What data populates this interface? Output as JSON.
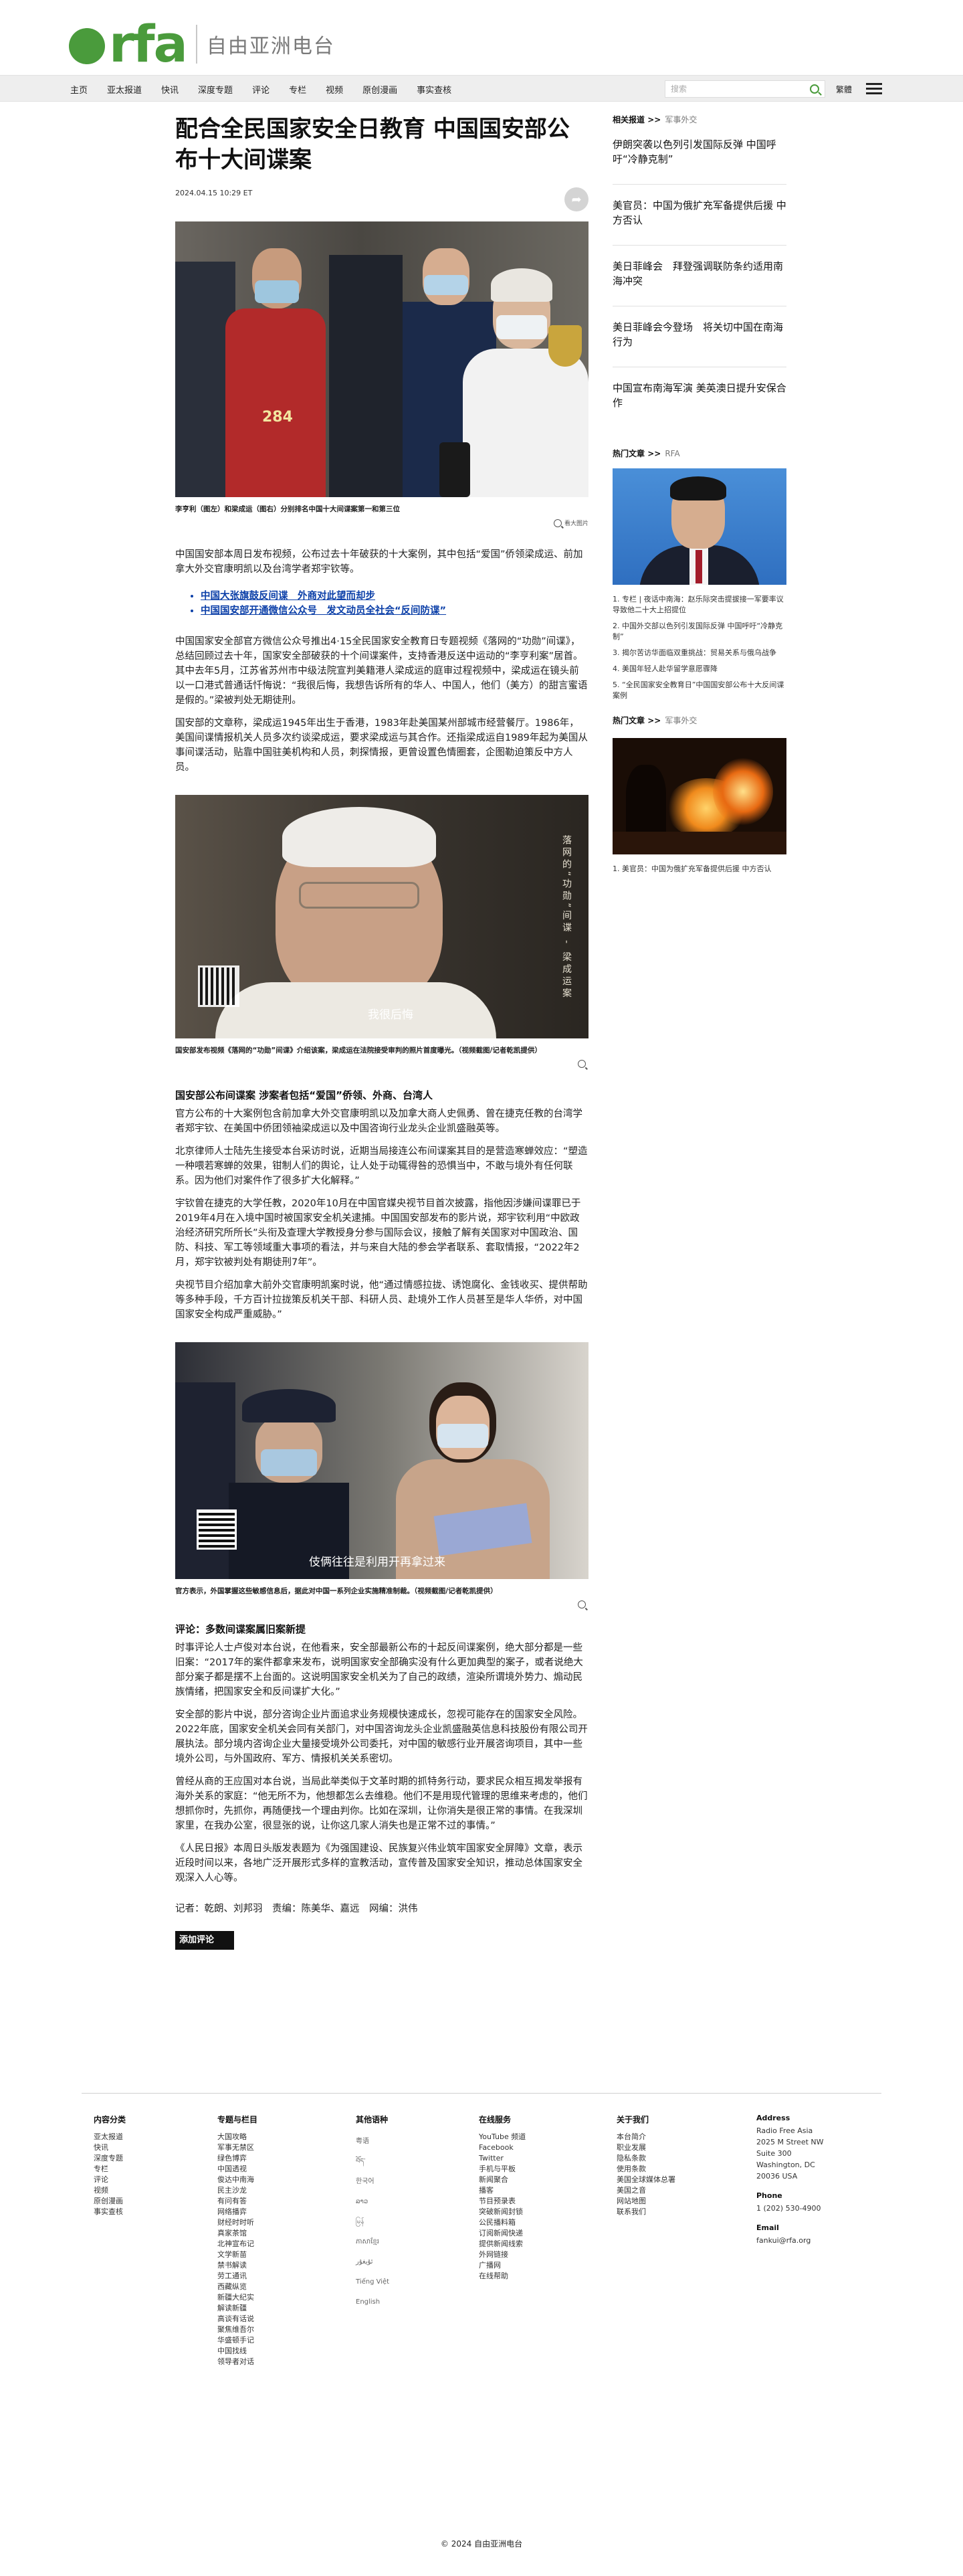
{
  "site": {
    "logo_text": "rfa",
    "name": "自由亚洲电台"
  },
  "nav": {
    "items": [
      "主页",
      "亚太报道",
      "快讯",
      "深度专题",
      "评论",
      "专栏",
      "视频",
      "原创漫画",
      "事实查核"
    ],
    "search_placeholder": "搜索",
    "lang_toggle": "繁體"
  },
  "article": {
    "headline": "配合全民国家安全日教育 中国国安部公布十大间谍案",
    "date": "2024.04.15 10:29 ET",
    "photo1_caption": "李亨利（图左）和梁成运（图右）分别排名中国十大间谍案第一和第三位",
    "enlarge_label": "看大图片",
    "para1": "中国国安部本周日发布视频，公布过去十年破获的十大案例，其中包括“爱国”侨领梁成运、前加拿大外交官康明凯以及台湾学者郑宇钦等。",
    "related": [
      "中国大张旗鼓反间谍　外商对此望而却步",
      "中国国安部开通微信公众号　发文动员全社会“反间防谍”"
    ],
    "para2": "中国国家安全部官方微信公众号推出4·15全民国家安全教育日专题视频《落网的“功勋”间谍》，总结回顾过去十年，国家安全部破获的十个间谍案件，支持香港反送中运动的“李亨利案”居首。其中去年5月，江苏省苏州市中级法院宣判美籍港人梁成运的庭审过程视频中，梁成运在镜头前以一口港式普通话忏悔说：“我很后悔，我想告诉所有的华人、中国人，他们（美方）的甜言蜜语是假的。”梁被判处无期徒刑。",
    "para3": "国安部的文章称，梁成运1945年出生于香港，1983年赴美国某州部城市经营餐厅。1986年，美国间谍情报机关人员多次约谈梁成运，要求梁成运与其合作。还指梁成运自1989年起为美国从事间谍活动，贴靠中国驻美机构和人员，刺探情报，更曾设置色情圈套，企图勒迫策反中方人员。",
    "photo2_vtext": "落网的“功勋”间谍 - 梁成运案",
    "photo2_subtitle": "我很后悔",
    "photo2_caption": "国安部发布视频《落网的“功勋”间谍》介绍该案，梁成运在法院接受审判的照片首度曝光。（视频截图/记者乾凯提供）",
    "subhead1": "国安部公布间谍案 涉案者包括“爱国”侨领、外商、台湾人",
    "para4": "官方公布的十大案例包含前加拿大外交官康明凯以及加拿大商人史佩勇、曾在捷克任教的台湾学者郑宇钦、在美国中侨团领袖梁成运以及中国咨询行业龙头企业凯盛融英等。",
    "para5": "北京律师人士陆先生接受本台采访时说，近期当局接连公布间谍案其目的是营造寒蝉效应：“塑造一种喂若寒蝉的效果，钳制人们的舆论，让人处于动辄得咎的恐惧当中，不敢与境外有任何联系。因为他们对案件作了很多扩大化解释。”",
    "para6": "宇钦曾在捷克的大学任教，2020年10月在中国官媒央视节目首次披露，指他因涉嫌间谍罪已于2019年4月在入境中国时被国家安全机关逮捕。中国国安部发布的影片说，郑宇钦利用“中欧政治经济研究所所长”头衔及查理大学教授身分参与国际会议，接触了解有关国家对中国政治、国防、科技、军工等领域重大事项的看法，并与来自大陆的参会学者联系、套取情报，“2022年2月，郑宇钦被判处有期徒刑7年”。",
    "para7": "央视节目介绍加拿大前外交官康明凯案时说，他“通过情感拉拢、诱饱腐化、金钱收买、提供帮助等多种手段，千方百计拉拢策反机关干部、科研人员、赴境外工作人员甚至是华人华侨，对中国国家安全构成严重威胁。”",
    "photo3_subtitle": "伎俩往往是利用开再拿过来",
    "photo3_caption": "官方表示，外国掌握这些敏感信息后，据此对中国一系列企业实施精准制裁。（视频截图/记者乾凯提供）",
    "subhead2": "评论：多数间谍案属旧案新提",
    "para8": "时事评论人士卢俊对本台说，在他看来，安全部最新公布的十起反间谍案例，绝大部分都是一些旧案：“2017年的案件都拿来发布，说明国家安全部确实没有什么更加典型的案子，或者说绝大部分案子都是摆不上台面的。这说明国家安全机关为了自己的政绩，渲染所谓境外势力、煽动民族情绪，把国家安全和反间谍扩大化。”",
    "para9": "安全部的影片中说，部分咨询企业片面追求业务规模快速成长，忽视可能存在的国家安全风险。2022年底，国家安全机关会同有关部门，对中国咨询龙头企业凯盛融英信息科技股份有限公司开展执法。部分境内咨询企业大量接受境外公司委托，对中国的敏感行业开展咨询项目，其中一些境外公司，与外国政府、军方、情报机关关系密切。",
    "para10": "曾经从商的王应国对本台说，当局此举类似于文革时期的抓特务行动，要求民众相互揭发举报有海外关系的家庭：“他无所不为，他想都怎么去维稳。他们不是用现代管理的思维来考虑的，他们想抓你时，先抓你，再随便找一个理由判你。比如在深圳，让你消失是很正常的事情。在我深圳家里，在我办公室，很显张的说，让你这几家人消失也是正常不过的事情。”",
    "para11": "《人民日报》本周日头版发表题为《为强国建设、民族复兴伟业筑牢国家安全屏障》文章，表示近段时间以来，各地广泛开展形式多样的宣教活动，宣传普及国家安全知识，推动总体国家安全观深入人心等。",
    "credits": "记者：乾朗、刘邦羽　责编：陈美华、嘉远　网编：洪伟",
    "comment_button": "添加评论"
  },
  "sidebar": {
    "related_label": "相关报道",
    "related_arrow": ">>",
    "related_tag": "军事外交",
    "related_items": [
      "伊朗突袭以色列引发国际反弹 中国呼吁“冷静克制”",
      "美官员：中国为俄扩充军备提供后援 中方否认",
      "美日菲峰会　拜登强调联防条约适用南海冲突",
      "美日菲峰会今登场　将关切中国在南海行为",
      "中国宣布南海军演 美英澳日提升安保合作"
    ],
    "popular_label": "热门文章",
    "popular_arrow": ">>",
    "popular_tag": "RFA",
    "popular_items": [
      "1. 专栏 | 夜话中南海：赵乐际突击提拔接一军要率议导致他二十大上招提位",
      "2. 中国外交部以色列引发国际反弹 中国呼吁“冷静克制”",
      "3. 揭尔苦访华面临双重挑战：贸易关系与俄乌战争",
      "4. 美国年轻人赴华留学意愿骤降",
      "5. “全民国家安全教育日”中国国安部公布十大反间谍案例"
    ],
    "popular2_label": "热门文章",
    "popular2_arrow": ">>",
    "popular2_tag": "军事外交",
    "popular2_items": [
      "1. 美官员：中国为俄扩充军备提供后援 中方否认"
    ]
  },
  "footer": {
    "col1_title": "内容分类",
    "col1_items": [
      "亚太报道",
      "快讯",
      "深度专题",
      "专栏",
      "评论",
      "视频",
      "原创漫画",
      "事实查核"
    ],
    "col2_title": "专题与栏目",
    "col2_items": [
      "大国攻略",
      "军事无禁区",
      "绿色博弈",
      "中国透视",
      "俊达中南海",
      "民主沙龙",
      "有问有答",
      "网络播弈",
      "财经时时听",
      "真家茶馆",
      "北神宣布记",
      "文学新苗",
      "禁书解读",
      "劳工通讯",
      "西藏纵览",
      "新疆大纪实",
      "解读新疆",
      "高谈有话说",
      "聚焦维吾尔",
      "华盛顿手记",
      "中国找线",
      "领导者对话"
    ],
    "col3_title": "其他语种",
    "col3_items": [
      "粤语",
      "བོད་",
      "한국어",
      "ລາວ",
      "မြန်",
      "ភាសាខ្មែរ",
      "ئۇيغۇر",
      "Tiếng Việt",
      "English"
    ],
    "col4_title": "在线服务",
    "col4_items": [
      "YouTube 频道",
      "Facebook",
      "Twitter",
      "手机与平板",
      "新闻聚合",
      "播客",
      "节目预录表",
      "突破新闻封锁",
      "公民播料箱",
      "订阅新闻快递",
      "提供新闻线索",
      "外网链接",
      "广播网",
      "在线帮助"
    ],
    "col5_title": "关于我们",
    "col5_items": [
      "本台简介",
      "职业发展",
      "隐私条款",
      "使用条款",
      "美国全球媒体总署",
      "美国之音",
      "网站地图",
      "联系我们"
    ],
    "address_label": "Address",
    "address_lines": [
      "Radio Free Asia",
      "2025 M Street NW",
      "Suite 300",
      "Washington, DC",
      "20036 USA"
    ],
    "phone_label": "Phone",
    "phone": "1 (202) 530-4900",
    "email_label": "Email",
    "email": "fankui@rfa.org",
    "copyright": "© 2024 自由亚洲电台"
  }
}
